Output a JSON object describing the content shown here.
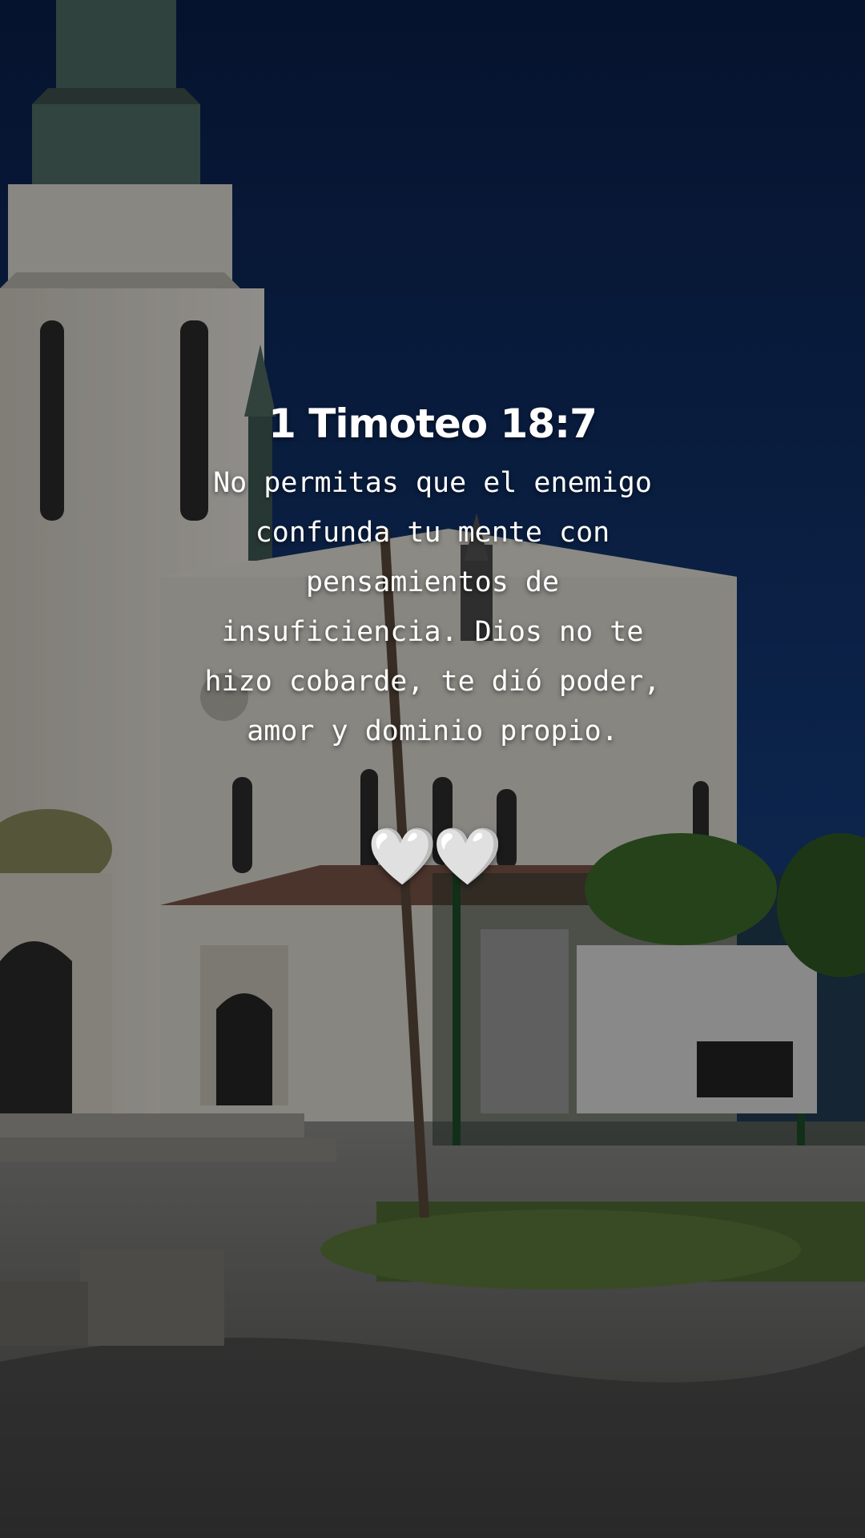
{
  "verse": {
    "reference": "1 Timoteo 18:7",
    "text": "No permitas que el enemigo confunda tu mente con pensamientos de insuficiencia. Dios no te hizo cobarde, te dió poder, amor y dominio propio."
  },
  "decoration": {
    "hearts": [
      "🤍",
      "🤍"
    ],
    "heart_icon": "white-heart-icon"
  },
  "colors": {
    "sky": "#0e2a5e",
    "text": "#ffffff",
    "church_wall": "#d7d3c9"
  }
}
